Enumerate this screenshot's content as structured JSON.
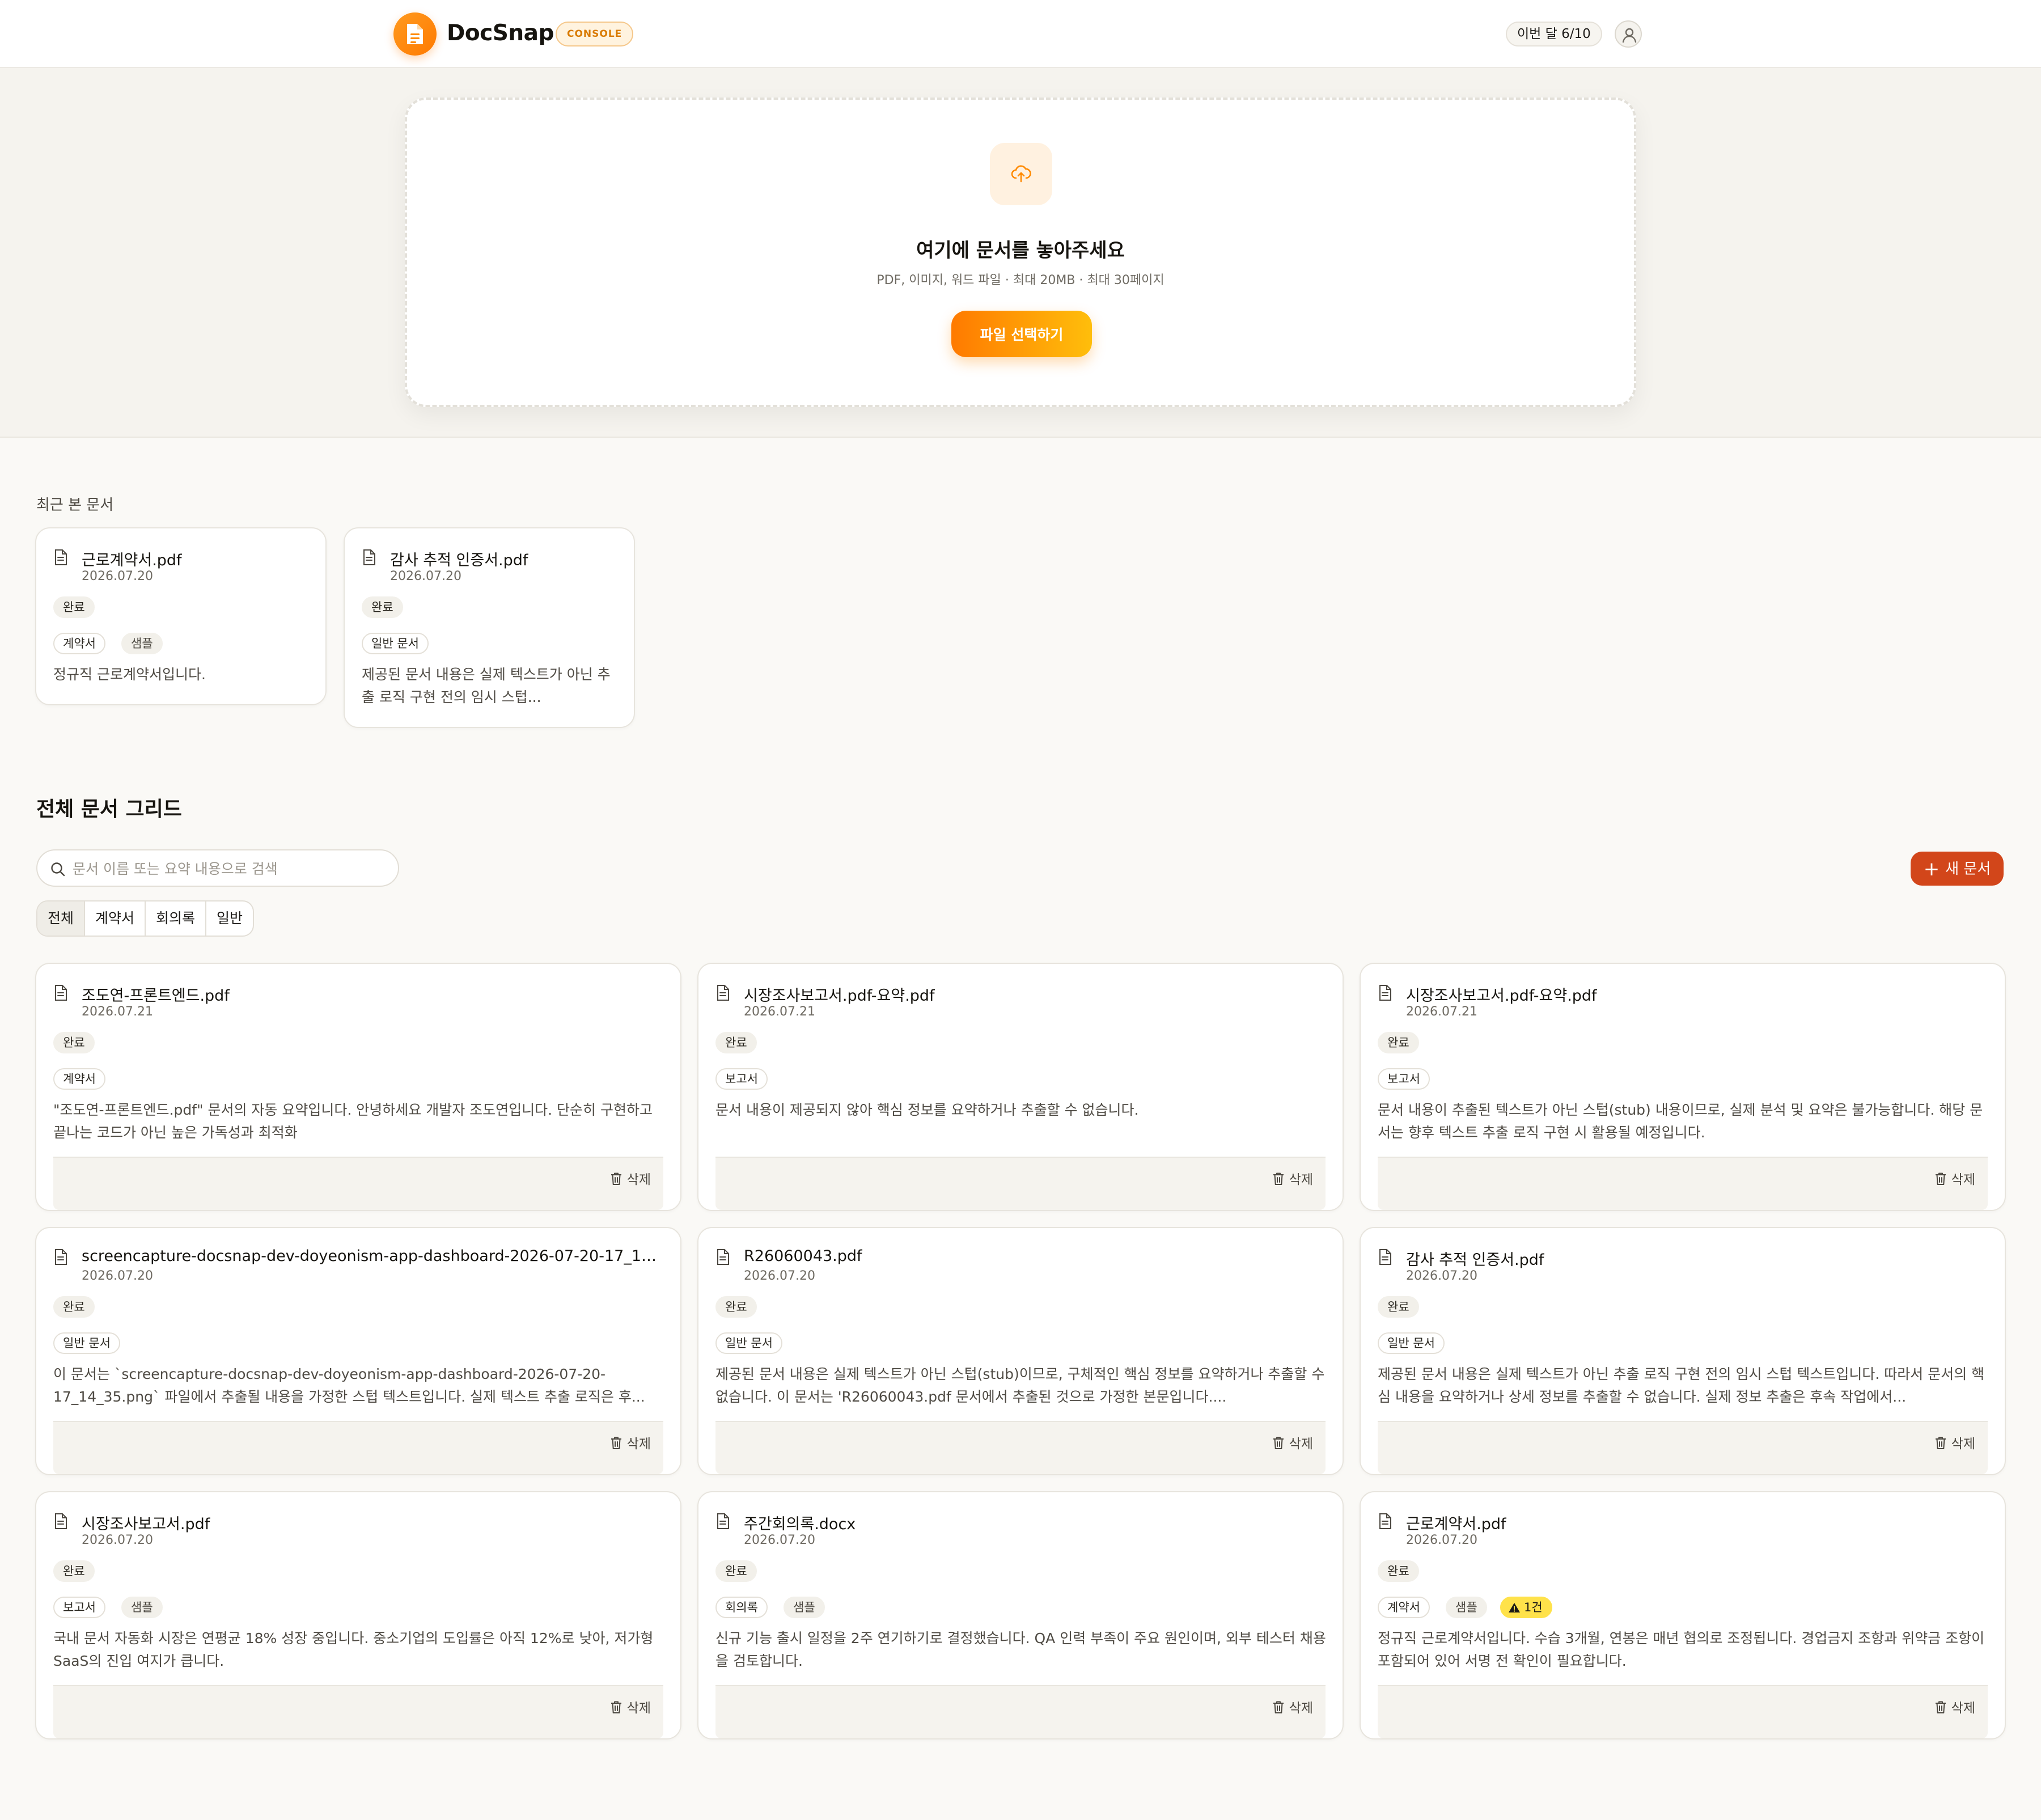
{
  "app": {
    "brand": "DocSnap",
    "badge": "CONSOLE",
    "usage": "이번 달 6/10"
  },
  "upload": {
    "title": "여기에 문서를 놓아주세요",
    "subtitle": "PDF, 이미지, 워드 파일 · 최대 20MB · 최대 30페이지",
    "button": "파일 선택하기"
  },
  "recent": {
    "title": "최근 본 문서",
    "items": [
      {
        "name": "근로계약서.pdf",
        "date": "2026.07.20",
        "status": "완료",
        "tags": [
          "계약서",
          "샘플"
        ],
        "summary": "정규직 근로계약서입니다."
      },
      {
        "name": "감사 추적 인증서.pdf",
        "date": "2026.07.20",
        "status": "완료",
        "tags": [
          "일반 문서"
        ],
        "summary": "제공된 문서 내용은 실제 텍스트가 아닌 추출 로직 구현 전의 임시 스텁..."
      }
    ]
  },
  "grid": {
    "title": "전체 문서 그리드",
    "search_placeholder": "문서 이름 또는 요약 내용으로 검색",
    "new_button": "새 문서",
    "filters": [
      "전체",
      "계약서",
      "회의록",
      "일반"
    ],
    "active_filter": "전체",
    "delete_label": "삭제",
    "docs": [
      {
        "name": "조도연-프론트엔드.pdf",
        "date": "2026.07.21",
        "status": "완료",
        "tags": [
          "계약서"
        ],
        "summary": "\"조도연-프론트엔드.pdf\" 문서의 자동 요약입니다. 안녕하세요 개발자 조도연입니다. 단순히 구현하고 끝나는 코드가 아닌 높은 가독성과 최적화"
      },
      {
        "name": "시장조사보고서.pdf-요약.pdf",
        "date": "2026.07.21",
        "status": "완료",
        "tags": [
          "보고서"
        ],
        "summary": "문서 내용이 제공되지 않아 핵심 정보를 요약하거나 추출할 수 없습니다."
      },
      {
        "name": "시장조사보고서.pdf-요약.pdf",
        "date": "2026.07.21",
        "status": "완료",
        "tags": [
          "보고서"
        ],
        "summary": "문서 내용이 추출된 텍스트가 아닌 스텁(stub) 내용이므로, 실제 분석 및 요약은 불가능합니다. 해당 문서는 향후 텍스트 추출 로직 구현 시 활용될 예정입니다."
      },
      {
        "name": "screencapture-docsnap-dev-doyeonism-app-dashboard-2026-07-20-17_14_3...",
        "date": "2026.07.20",
        "status": "완료",
        "tags": [
          "일반 문서"
        ],
        "summary": "이 문서는 `screencapture-docsnap-dev-doyeonism-app-dashboard-2026-07-20-17_14_35.png` 파일에서 추출될 내용을 가정한 스텁 텍스트입니다. 실제 텍스트 추출 로직은 후..."
      },
      {
        "name": "R26060043.pdf",
        "date": "2026.07.20",
        "status": "완료",
        "tags": [
          "일반 문서"
        ],
        "summary": "제공된 문서 내용은 실제 텍스트가 아닌 스텁(stub)이므로, 구체적인 핵심 정보를 요약하거나 추출할 수 없습니다. 이 문서는 'R26060043.pdf 문서에서 추출된 것으로 가정한 본문입니다...."
      },
      {
        "name": "감사 추적 인증서.pdf",
        "date": "2026.07.20",
        "status": "완료",
        "tags": [
          "일반 문서"
        ],
        "summary": "제공된 문서 내용은 실제 텍스트가 아닌 추출 로직 구현 전의 임시 스텁 텍스트입니다. 따라서 문서의 핵심 내용을 요약하거나 상세 정보를 추출할 수 없습니다. 실제 정보 추출은 후속 작업에서..."
      },
      {
        "name": "시장조사보고서.pdf",
        "date": "2026.07.20",
        "status": "완료",
        "tags": [
          "보고서",
          "샘플"
        ],
        "summary": "국내 문서 자동화 시장은 연평균 18% 성장 중입니다. 중소기업의 도입률은 아직 12%로 낮아, 저가형 SaaS의 진입 여지가 큽니다."
      },
      {
        "name": "주간회의록.docx",
        "date": "2026.07.20",
        "status": "완료",
        "tags": [
          "회의록",
          "샘플"
        ],
        "summary": "신규 기능 출시 일정을 2주 연기하기로 결정했습니다. QA 인력 부족이 주요 원인이며, 외부 테스터 채용을 검토합니다."
      },
      {
        "name": "근로계약서.pdf",
        "date": "2026.07.20",
        "status": "완료",
        "tags": [
          "계약서",
          "샘플"
        ],
        "warning": "1건",
        "summary": "정규직 근로계약서입니다. 수습 3개월, 연봉은 매년 협의로 조정됩니다. 경업금지 조항과 위약금 조항이 포함되어 있어 서명 전 확인이 필요합니다."
      }
    ]
  },
  "colors": {
    "accent": "#FF7A00",
    "accent_end": "#FFBE0B",
    "new_button": "#D2461A",
    "warning": "#FFE24A",
    "background": "#FAF9F6"
  },
  "icons": {
    "logo": "document-icon",
    "upload": "cloud-upload-icon",
    "avatar": "user-icon",
    "search": "search-icon",
    "delete": "trash-icon",
    "doc": "file-icon",
    "warning": "warning-triangle-icon",
    "new": "plus-icon"
  }
}
